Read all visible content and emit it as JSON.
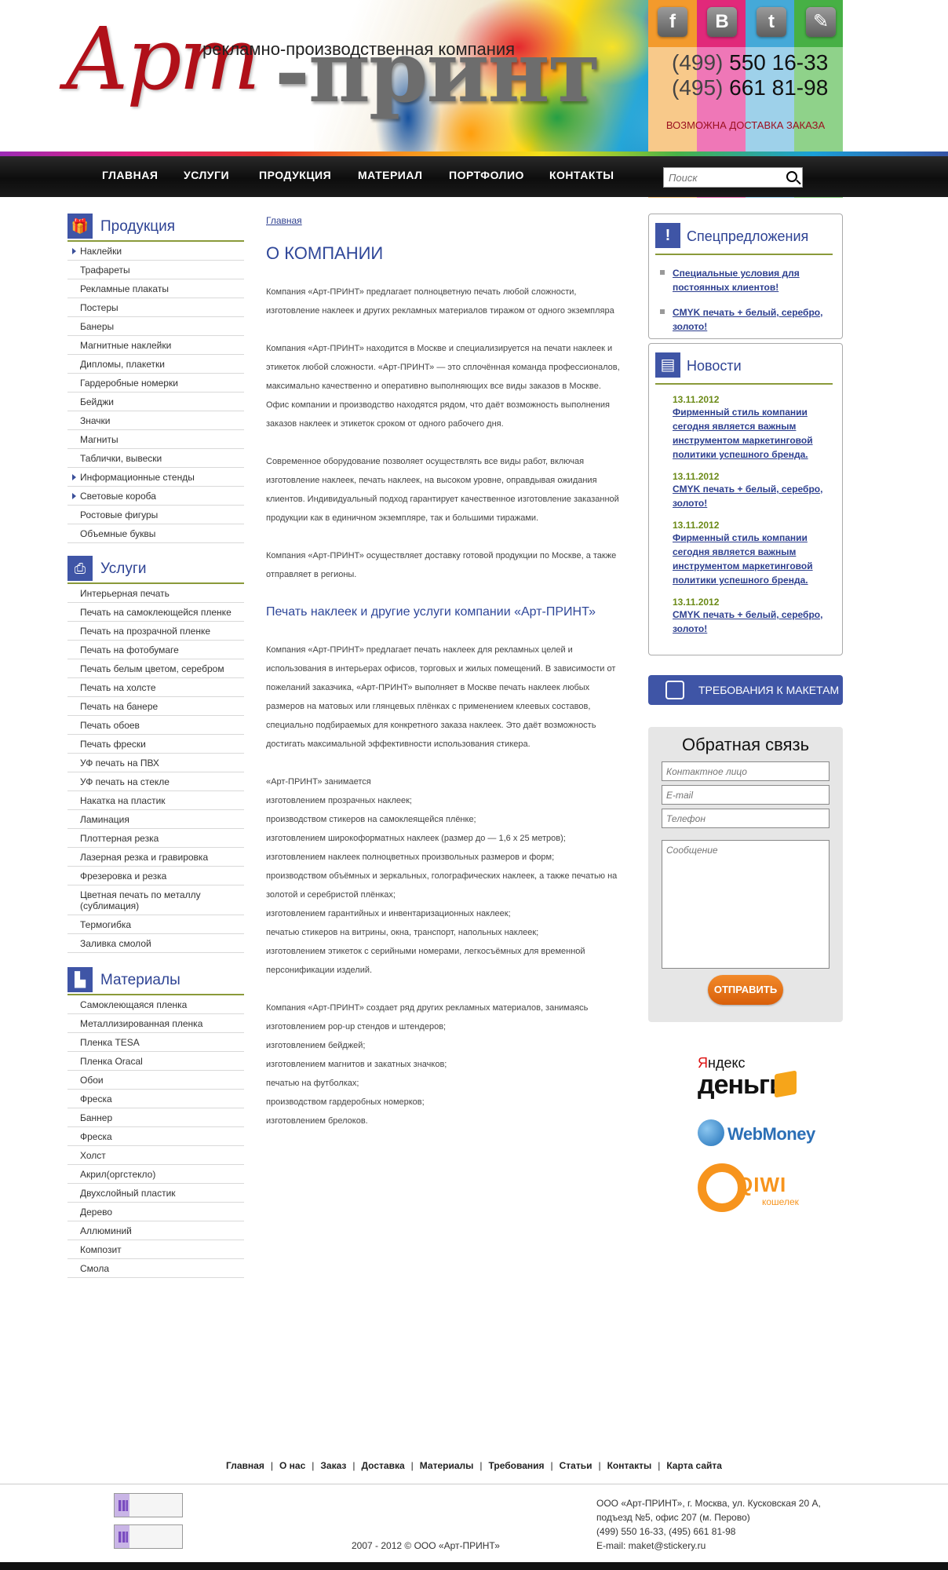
{
  "header": {
    "logo_script": "Арт",
    "logo_dash": "-принт",
    "tagline": "рекламно-производственная компания",
    "phones": [
      {
        "code": "(499)",
        "number": "550 16-33"
      },
      {
        "code": "(495)",
        "number": "661 81-98"
      }
    ],
    "delivery": "ВОЗМОЖНА ДОСТАВКА ЗАКАЗА",
    "social": [
      {
        "name": "facebook-icon",
        "glyph": "f"
      },
      {
        "name": "vkontakte-icon",
        "glyph": "B"
      },
      {
        "name": "twitter-icon",
        "glyph": "t"
      },
      {
        "name": "livejournal-icon",
        "glyph": "✎"
      }
    ],
    "search_placeholder": "Поиск",
    "nav": [
      "ГЛАВНАЯ",
      "УСЛУГИ",
      "ПРОДУКЦИЯ",
      "МАТЕРИАЛ",
      "ПОРТФОЛИО",
      "КОНТАКТЫ"
    ]
  },
  "sidebar": {
    "products": {
      "title": "Продукция",
      "items": [
        "Наклейки",
        "Трафареты",
        "Рекламные плакаты",
        "Постеры",
        "Банеры",
        "Магнитные наклейки",
        "Дипломы, плакетки",
        "Гардеробные номерки",
        "Бейджи",
        "Значки",
        "Магниты",
        "Таблички, вывески",
        "Информационные стенды",
        "Световые короба",
        "Ростовые фигуры",
        "Объемные буквы"
      ]
    },
    "services": {
      "title": "Услуги",
      "items": [
        "Интерьерная печать",
        "Печать на самоклеющейся пленке",
        "Печать на прозрачной пленке",
        "Печать на фотобумаге",
        "Печать белым цветом, серебром",
        "Печать на холсте",
        "Печать на банере",
        "Печать обоев",
        "Печать фрески",
        "УФ печать на ПВХ",
        "УФ печать на стекле",
        "Накатка на пластик",
        "Ламинация",
        "Плоттерная резка",
        "Лазерная резка и гравировка",
        "Фрезеровка и резка",
        "Цветная печать по металлу (сублимация)",
        "Термогибка",
        "Заливка смолой"
      ]
    },
    "materials": {
      "title": "Материалы",
      "items": [
        "Самоклеющаяся пленка",
        "Металлизированная пленка",
        "Пленка TESA",
        "Пленка Oracal",
        "Обои",
        "Фреска",
        "Баннер",
        "Фреска",
        "Холст",
        "Акрил(оргстекло)",
        "Двухслойный пластик",
        "Дерево",
        "Аллюминий",
        "Композит",
        "Смола"
      ]
    }
  },
  "main": {
    "breadcrumb": "Главная",
    "title": "О КОМПАНИИ",
    "p1": "Компания «Арт-ПРИНТ» предлагает полноцветную печать любой сложности, изготовление наклеек и других рекламных материалов тиражом от одного экземпляра",
    "p2": "Компания «Арт-ПРИНТ» находится в Москве и специализируется на печати наклеек и этикеток любой сложности. «Арт-ПРИНТ» — это сплочённая команда профессионалов, максимально качественно и оперативно выполняющих все виды заказов в Москве. Офис компании и производство находятся рядом, что даёт возможность выполнения заказов наклеек и этикеток сроком от одного рабочего дня.",
    "p3": "Современное оборудование позволяет осуществлять все виды работ, включая изготовление наклеек, печать наклеек, на высоком уровне, оправдывая ожидания клиентов. Индивидуальный подход гарантирует качественное изготовление заказанной продукции как в единичном экземпляре, так и большими тиражами.",
    "p4": "Компания «Арт-ПРИНТ» осуществляет доставку готовой продукции по Москве, а также отправляет в регионы.",
    "subtitle": "Печать наклеек и другие услуги компании «Арт-ПРИНТ»",
    "p5": "Компания «Арт-ПРИНТ» предлагает печать наклеек для рекламных целей и использования в интерьерах офисов, торговых и жилых помещений. В зависимости от пожеланий заказчика, «Арт-ПРИНТ» выполняет в Москве печать наклеек любых размеров на матовых или глянцевых плёнках с применением клеевых составов, специально подбираемых для конкретного заказа наклеек. Это даёт возможность достигать максимальной эффективности использования стикера.",
    "list1_intro": "«Арт-ПРИНТ» занимается",
    "list1": [
      "изготовлением прозрачных наклеек;",
      "производством стикеров на самоклеящейся плёнке;",
      "изготовлением широкоформатных наклеек (размер до — 1,6 х 25 метров);",
      "изготовлением наклеек полноцветных произвольных размеров и форм;",
      "производством объёмных и зеркальных, голографических наклеек, а также печатью на золотой и серебристой плёнках;",
      "изготовлением гарантийных и инвентаризационных наклеек;",
      "печатью стикеров на витрины, окна, транспорт, напольных наклеек;",
      "изготовлением этикеток с серийными номерами, легкосъёмных для временной персонификации изделий."
    ],
    "list2_intro": "Компания «Арт-ПРИНТ» создает ряд других рекламных материалов, занимаясь",
    "list2": [
      "изготовлением pop-up стендов и штендеров;",
      "изготовлением бейджей;",
      "изготовлением магнитов и закатных значков;",
      "печатью на футболках;",
      "производством гардеробных номерков;",
      "изготовлением брелоков."
    ]
  },
  "right": {
    "special": {
      "title": "Спецпредложения",
      "items": [
        "Специальные условия для постоянных клиентов!",
        "CMYK печать + белый, серебро, золото!"
      ]
    },
    "news": {
      "title": "Новости",
      "items": [
        {
          "date": "13.11.2012",
          "text": "Фирменный стиль компании сегодня является важным инструментом маркетинговой политики успешного бренда."
        },
        {
          "date": "13.11.2012",
          "text": "CMYK печать + белый, серебро, золото!"
        },
        {
          "date": "13.11.2012",
          "text": "Фирменный стиль компании сегодня является важным инструментом маркетинговой политики успешного бренда."
        },
        {
          "date": "13.11.2012",
          "text": "CMYK печать + белый, серебро, золото!"
        }
      ]
    },
    "requirements_button": "ТРЕБОВАНИЯ К МАКЕТАМ",
    "feedback": {
      "title": "Обратная связь",
      "contact_placeholder": "Контактное лицо",
      "email_placeholder": "E-mail",
      "phone_placeholder": "Телефон",
      "message_placeholder": "Сообщение",
      "send_label": "ОТПРАВИТЬ"
    },
    "payments": {
      "yandex_top_red": "Я",
      "yandex_top": "ндекс",
      "yandex_bottom": "деньги",
      "webmoney": "WebMoney",
      "qiwi": "QIWI",
      "qiwi_sub": "кошелек"
    }
  },
  "footer": {
    "links": [
      "Главная",
      "О нас",
      "Заказ",
      "Доставка",
      "Материалы",
      "Требования",
      "Статьи",
      "Контакты",
      "Карта сайта"
    ],
    "copyright": "2007 - 2012  © ООО «Арт-ПРИНТ»",
    "address": [
      "ООО «Арт-ПРИНТ», г. Москва, ул. Кусковская 20 А,",
      "подъезд №5, офис 207 (м. Перово)",
      "(499) 550 16-33, (495) 661 81-98",
      "E-mail: maket@stickery.ru"
    ]
  }
}
